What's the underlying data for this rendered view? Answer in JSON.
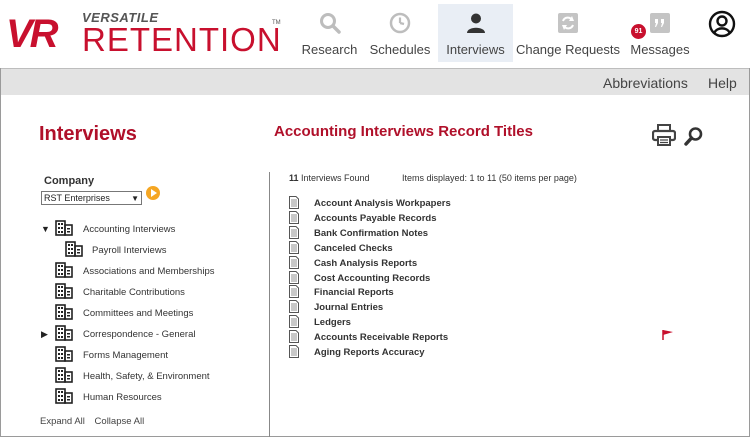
{
  "brand": {
    "top": "VERSATILE",
    "main": "RETENTION",
    "mark": "VR",
    "tm": "TM"
  },
  "nav": [
    {
      "label": "Research",
      "icon": "search-icon",
      "active": false
    },
    {
      "label": "Schedules",
      "icon": "clock-icon",
      "active": false
    },
    {
      "label": "Interviews",
      "icon": "person-icon",
      "active": true
    },
    {
      "label": "Change Requests",
      "icon": "refresh-icon",
      "active": false
    },
    {
      "label": "Messages",
      "icon": "quote-icon",
      "active": false,
      "badge": "91"
    }
  ],
  "subbar": {
    "abbreviations": "Abbreviations",
    "help": "Help"
  },
  "left": {
    "title": "Interviews",
    "company_label": "Company",
    "company_value": "RST Enterprises",
    "tree": [
      {
        "label": "Accounting Interviews",
        "toggle": "▼",
        "child": false
      },
      {
        "label": "Payroll Interviews",
        "toggle": "",
        "child": true
      },
      {
        "label": "Associations and Memberships",
        "toggle": "",
        "child": false
      },
      {
        "label": "Charitable Contributions",
        "toggle": "",
        "child": false
      },
      {
        "label": "Committees and Meetings",
        "toggle": "",
        "child": false
      },
      {
        "label": "Correspondence - General",
        "toggle": "▶",
        "child": false
      },
      {
        "label": "Forms Management",
        "toggle": "",
        "child": false
      },
      {
        "label": "Health, Safety, & Environment",
        "toggle": "",
        "child": false
      },
      {
        "label": "Human Resources",
        "toggle": "",
        "child": false
      }
    ],
    "expand_all": "Expand All",
    "collapse_all": "Collapse All"
  },
  "right": {
    "title": "Accounting Interviews Record Titles",
    "found_count": "11",
    "found_text": " Interviews Found",
    "displayed": "Items displayed: 1 to 11 (50 items per page)",
    "records": [
      {
        "label": "Account Analysis Workpapers",
        "flagged": false
      },
      {
        "label": "Accounts Payable Records",
        "flagged": false
      },
      {
        "label": "Bank Confirmation Notes",
        "flagged": false
      },
      {
        "label": "Canceled Checks",
        "flagged": false
      },
      {
        "label": "Cash Analysis Reports",
        "flagged": false
      },
      {
        "label": "Cost Accounting Records",
        "flagged": false
      },
      {
        "label": "Financial Reports",
        "flagged": false
      },
      {
        "label": "Journal Entries",
        "flagged": false
      },
      {
        "label": "Ledgers",
        "flagged": false
      },
      {
        "label": "Accounts Receivable Reports",
        "flagged": true
      },
      {
        "label": "Aging Reports Accuracy",
        "flagged": false
      }
    ]
  },
  "colors": {
    "brand_red": "#c8102e",
    "active_tab": "#e9eef5",
    "go_button": "#f5a623"
  }
}
